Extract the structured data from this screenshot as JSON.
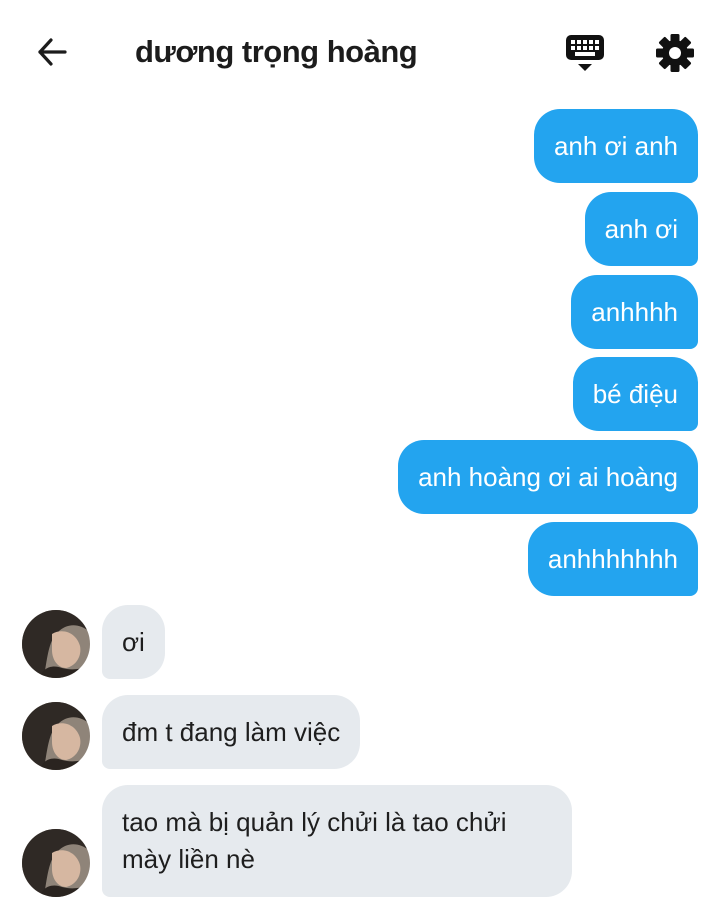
{
  "header": {
    "title": "dương trọng hoàng"
  },
  "messages": {
    "outgoing": [
      "anh ơi anh",
      "anh ơi",
      "anhhhh",
      "bé điệu",
      "anh hoàng ơi ai hoàng",
      "anhhhhhhh"
    ],
    "incoming": [
      "ơi",
      "đm t đang làm việc",
      "tao mà bị quản lý chửi là tao chửi mày liền nè"
    ]
  },
  "colors": {
    "outgoing_bubble": "#23a4ef",
    "incoming_bubble": "#e6eaee"
  },
  "icons": [
    "back-arrow-icon",
    "keyboard-icon",
    "gear-icon"
  ]
}
